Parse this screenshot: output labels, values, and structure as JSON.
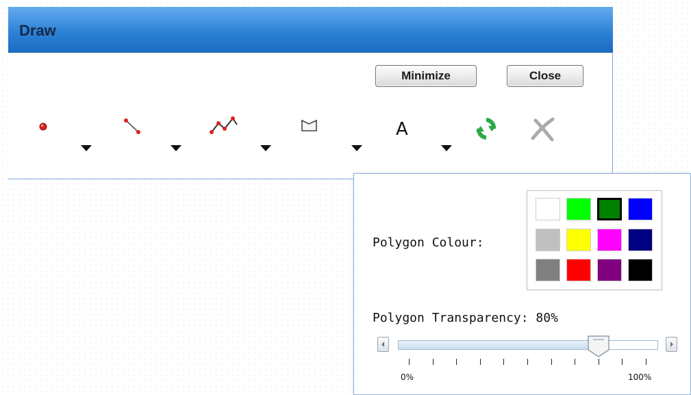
{
  "panel": {
    "title": "Draw",
    "minimize_label": "Minimize",
    "close_label": "Close",
    "tools": [
      {
        "name": "point-tool",
        "icon": "point-icon"
      },
      {
        "name": "line-tool",
        "icon": "line-icon"
      },
      {
        "name": "polyline-tool",
        "icon": "polyline-icon"
      },
      {
        "name": "polygon-tool",
        "icon": "polygon-icon"
      },
      {
        "name": "text-tool",
        "icon": "text-icon",
        "glyph": "A"
      },
      {
        "name": "refresh-tool",
        "icon": "refresh-icon"
      },
      {
        "name": "clear-tool",
        "icon": "clear-icon"
      }
    ]
  },
  "popover": {
    "colour_label": "Polygon Colour:",
    "transparency_label": "Polygon Transparency: 80%",
    "transparency_value": 80,
    "slider_min_label": "0%",
    "slider_max_label": "100%",
    "palette": [
      [
        "#ffffff",
        "#00ff00",
        "#008000",
        "#0000ff"
      ],
      [
        "#c0c0c0",
        "#ffff00",
        "#ff00ff",
        "#000080"
      ],
      [
        "#808080",
        "#ff0000",
        "#800080",
        "#000000"
      ]
    ],
    "selected_color": "#008000"
  },
  "colors": {
    "header_start": "#64abf0",
    "header_end": "#1c6bc2",
    "accent_green": "#2ea84a",
    "point_red": "#e02020"
  }
}
